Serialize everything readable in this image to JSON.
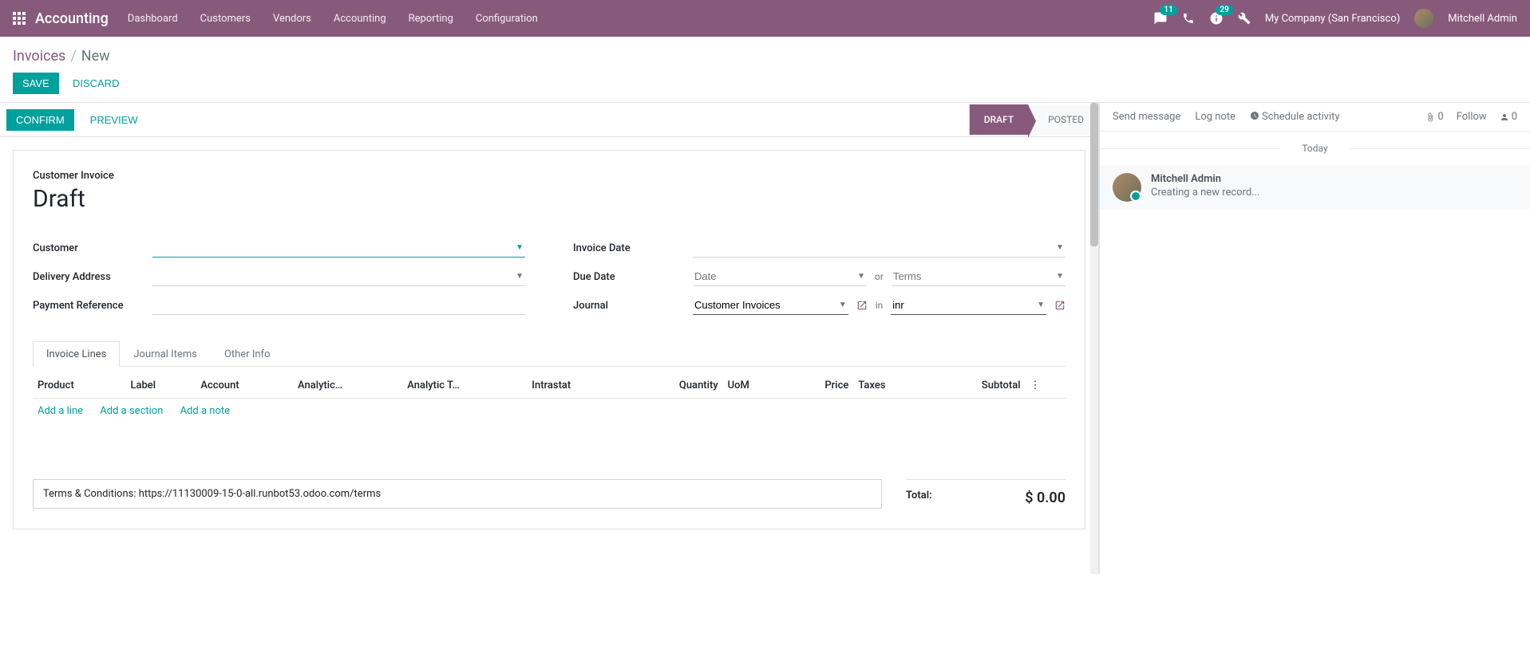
{
  "navbar": {
    "app_name": "Accounting",
    "menu": [
      "Dashboard",
      "Customers",
      "Vendors",
      "Accounting",
      "Reporting",
      "Configuration"
    ],
    "messages_badge": "11",
    "activities_badge": "29",
    "company": "My Company (San Francisco)",
    "user": "Mitchell Admin"
  },
  "breadcrumb": {
    "parent": "Invoices",
    "current": "New"
  },
  "buttons": {
    "save": "Save",
    "discard": "Discard",
    "confirm": "Confirm",
    "preview": "Preview"
  },
  "stages": {
    "draft": "Draft",
    "posted": "Posted"
  },
  "sheet": {
    "title_small": "Customer Invoice",
    "title_big": "Draft",
    "labels": {
      "customer": "Customer",
      "delivery_address": "Delivery Address",
      "payment_reference": "Payment Reference",
      "invoice_date": "Invoice Date",
      "due_date": "Due Date",
      "journal": "Journal",
      "or": "or",
      "in": "in"
    },
    "values": {
      "customer": "",
      "delivery_address": "",
      "payment_reference": "",
      "invoice_date": "",
      "due_date": "",
      "due_date_placeholder": "Date",
      "terms_placeholder": "Terms",
      "journal": "Customer Invoices",
      "currency": "inr"
    },
    "tabs": [
      "Invoice Lines",
      "Journal Items",
      "Other Info"
    ],
    "columns": {
      "product": "Product",
      "label": "Label",
      "account": "Account",
      "analytic_acc": "Analytic…",
      "analytic_tag": "Analytic T…",
      "intrastat": "Intrastat",
      "quantity": "Quantity",
      "uom": "UoM",
      "price": "Price",
      "taxes": "Taxes",
      "subtotal": "Subtotal"
    },
    "add_links": {
      "line": "Add a line",
      "section": "Add a section",
      "note": "Add a note"
    },
    "terms": "Terms & Conditions: https://11130009-15-0-all.runbot53.odoo.com/terms",
    "totals": {
      "total_label": "Total:",
      "total_value": "$ 0.00"
    }
  },
  "chatter": {
    "send_message": "Send message",
    "log_note": "Log note",
    "schedule_activity": "Schedule activity",
    "attach_count": "0",
    "follow": "Follow",
    "followers": "0",
    "today": "Today",
    "message": {
      "author": "Mitchell Admin",
      "body": "Creating a new record..."
    }
  }
}
